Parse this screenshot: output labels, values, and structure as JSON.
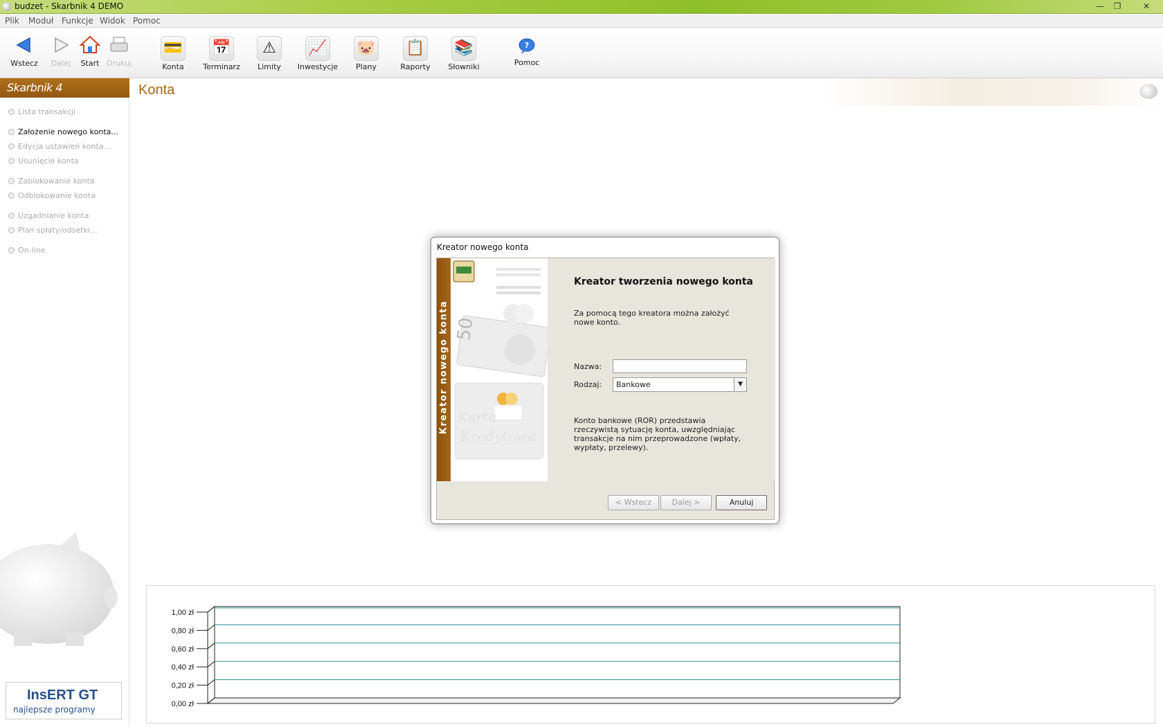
{
  "window": {
    "title": "budzet - Skarbnik 4 DEMO",
    "minimize": "—",
    "maximize": "❐",
    "close": "✕"
  },
  "menu": [
    "Plik",
    "Moduł",
    "Funkcje",
    "Widok",
    "Pomoc"
  ],
  "toolbar": {
    "wstecz": "Wstecz",
    "dalej": "Dalej",
    "start": "Start",
    "drukuj": "Drukuj",
    "konta": "Konta",
    "terminarz": "Terminarz",
    "limity": "Limity",
    "inwestycje": "Inwestycje",
    "plany": "Plany",
    "raporty": "Raporty",
    "slowniki": "Słowniki",
    "pomoc": "Pomoc"
  },
  "sidebar": {
    "header": "Skarbnik 4",
    "tasks": [
      "Lista transakcji",
      "Założenie nowego konta...",
      "Edycja ustawień konta...",
      "Usunięcie konta",
      "Zablokowanie konta",
      "Odblokowanie konta",
      "Uzgadnianie konta",
      "Plan spłaty/odsetki...",
      "On-line"
    ],
    "active_task_index": 1,
    "logo_brand": "InsERT GT",
    "logo_tagline": "najlepsze programy"
  },
  "main": {
    "title": "Konta"
  },
  "dialog": {
    "title": "Kreator nowego konta",
    "strip_text": "Kreator nowego konta",
    "heading": "Kreator tworzenia nowego konta",
    "intro": "Za pomocą tego kreatora można założyć nowe konto.",
    "nazwa_label": "Nazwa:",
    "nazwa_value": "",
    "rodzaj_label": "Rodzaj:",
    "rodzaj_value": "Bankowe",
    "description": "Konto bankowe (ROR) przedstawia rzeczywistą sytuację konta, uwzględniając transakcje na nim przeprowadzone (wpłaty, wypłaty, przelewy).",
    "buttons": {
      "back": "< Wstecz",
      "next": "Dalej >",
      "cancel": "Anuluj"
    }
  },
  "chart_data": {
    "type": "bar",
    "categories": [],
    "values": [],
    "yticks": [
      "0,00 zł",
      "0,20 zł",
      "0,40 zł",
      "0,60 zł",
      "0,80 zł",
      "1,00 zł"
    ],
    "ylim": [
      0,
      1
    ],
    "grid": true
  }
}
